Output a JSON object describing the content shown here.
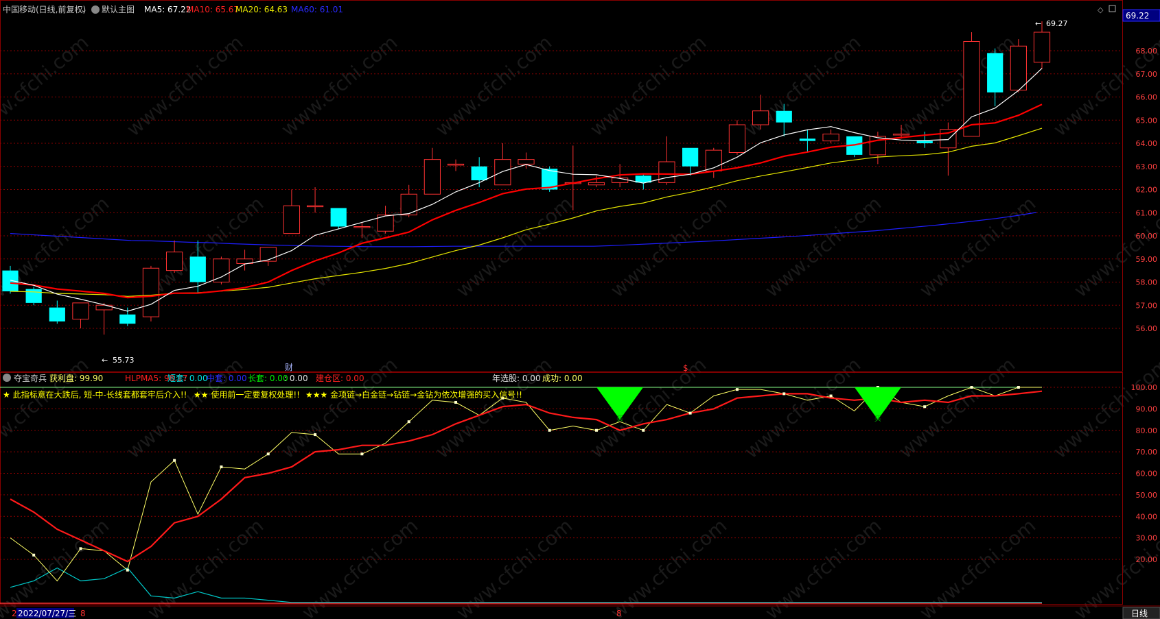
{
  "header": {
    "stock": "中国移动(日线,前复权)",
    "main_label": "默认主图",
    "ma5": "MA5: 67.22",
    "ma10": "MA10: 65.67",
    "ma20": "MA20: 64.63",
    "ma60": "MA60: 61.01"
  },
  "price_tag": "69.22",
  "annotations": {
    "high": "69.27",
    "low": "55.73",
    "cai_marker": "财",
    "dollar_marker": "$"
  },
  "indicator_header": {
    "name": "夺宝奇兵",
    "profit": "获利盘: 99.90",
    "hlpma5": "HLPMA5: 98.17",
    "short": "短套: 0.00",
    "mid": "中套: 0.00",
    "long_label": "长套: 0.00",
    "long_val": ": 0.00",
    "build_zone": "建仓区: 0.00",
    "year_pick": "年选股: 0.00",
    "success": "成功: 0.00"
  },
  "indicator_note": {
    "part1": "★ 此指标意在大跌后, 短-中-长线套都套牢后介入!!",
    "part2": "★★ 使用前一定要复权处理!!",
    "part3": "★★★ 金项链→白金链→钻链→金钻为依次增强的买入信号!!"
  },
  "bottom_bar": {
    "left_mark": "2",
    "date": "2022/07/27/三",
    "mid_mark": "8",
    "period_tab": "日线"
  },
  "buy_marker_label": "买",
  "watermark": "www.cfchi.com",
  "colors": {
    "up": "#ff3232",
    "down": "#00ffff",
    "ma5": "#ffffff",
    "ma10": "#ff0000",
    "ma20": "#e6e600",
    "ma60": "#1e1eff",
    "grid": "#8a0000",
    "profit": "#ffff66",
    "hlpma5": "#ff1a1a",
    "short": "#00cccc",
    "buy_signal": "#00ff00"
  },
  "chart_data": [
    {
      "type": "candlestick",
      "y_ticks": [
        "69.22",
        "68.00",
        "67.00",
        "66.00",
        "65.00",
        "64.00",
        "63.00",
        "62.00",
        "61.00",
        "60.00",
        "59.00",
        "58.00",
        "57.00",
        "56.00"
      ],
      "ylim": [
        55.5,
        69.5
      ],
      "candles": [
        {
          "o": 58.5,
          "c": 57.6,
          "h": 58.7,
          "l": 57.5
        },
        {
          "o": 57.7,
          "c": 57.1,
          "h": 57.8,
          "l": 57.0
        },
        {
          "o": 56.9,
          "c": 56.3,
          "h": 57.2,
          "l": 56.2
        },
        {
          "o": 56.4,
          "c": 57.1,
          "h": 57.1,
          "l": 56.0
        },
        {
          "o": 56.8,
          "c": 57.0,
          "h": 57.1,
          "l": 55.73
        },
        {
          "o": 56.6,
          "c": 56.2,
          "h": 56.9,
          "l": 56.1
        },
        {
          "o": 56.5,
          "c": 58.6,
          "h": 58.7,
          "l": 56.3
        },
        {
          "o": 58.5,
          "c": 59.3,
          "h": 59.8,
          "l": 58.4
        },
        {
          "o": 59.1,
          "c": 58.0,
          "h": 59.8,
          "l": 57.5
        },
        {
          "o": 58.0,
          "c": 59.0,
          "h": 59.1,
          "l": 57.9
        },
        {
          "o": 58.8,
          "c": 59.0,
          "h": 59.4,
          "l": 58.5
        },
        {
          "o": 58.9,
          "c": 59.5,
          "h": 59.5,
          "l": 58.7
        },
        {
          "o": 60.1,
          "c": 61.3,
          "h": 62.0,
          "l": 60.1
        },
        {
          "o": 61.3,
          "c": 61.3,
          "h": 62.1,
          "l": 61.0
        },
        {
          "o": 61.2,
          "c": 60.4,
          "h": 61.2,
          "l": 60.3
        },
        {
          "o": 60.4,
          "c": 60.4,
          "h": 60.6,
          "l": 59.9
        },
        {
          "o": 60.2,
          "c": 60.9,
          "h": 61.3,
          "l": 60.1
        },
        {
          "o": 60.9,
          "c": 61.8,
          "h": 62.2,
          "l": 60.8
        },
        {
          "o": 61.8,
          "c": 63.3,
          "h": 63.8,
          "l": 61.8
        },
        {
          "o": 63.1,
          "c": 63.1,
          "h": 63.3,
          "l": 62.8
        },
        {
          "o": 63.0,
          "c": 62.4,
          "h": 63.4,
          "l": 62.1
        },
        {
          "o": 62.2,
          "c": 63.3,
          "h": 64.0,
          "l": 62.2
        },
        {
          "o": 63.1,
          "c": 63.3,
          "h": 63.6,
          "l": 62.9
        },
        {
          "o": 62.9,
          "c": 62.0,
          "h": 63.0,
          "l": 61.9
        },
        {
          "o": 62.3,
          "c": 62.3,
          "h": 63.9,
          "l": 61.1
        },
        {
          "o": 62.2,
          "c": 62.3,
          "h": 62.6,
          "l": 62.1
        },
        {
          "o": 62.3,
          "c": 62.5,
          "h": 63.1,
          "l": 62.1
        },
        {
          "o": 62.6,
          "c": 62.3,
          "h": 62.7,
          "l": 62.0
        },
        {
          "o": 62.3,
          "c": 63.2,
          "h": 64.3,
          "l": 62.2
        },
        {
          "o": 63.8,
          "c": 63.0,
          "h": 63.8,
          "l": 62.6
        },
        {
          "o": 62.8,
          "c": 63.7,
          "h": 63.8,
          "l": 62.5
        },
        {
          "o": 63.6,
          "c": 64.8,
          "h": 65.0,
          "l": 63.5
        },
        {
          "o": 64.8,
          "c": 65.4,
          "h": 66.1,
          "l": 64.6
        },
        {
          "o": 65.4,
          "c": 64.9,
          "h": 65.7,
          "l": 64.3
        },
        {
          "o": 64.2,
          "c": 64.1,
          "h": 64.6,
          "l": 63.6
        },
        {
          "o": 64.1,
          "c": 64.4,
          "h": 64.6,
          "l": 64.0
        },
        {
          "o": 64.3,
          "c": 63.5,
          "h": 64.3,
          "l": 63.4
        },
        {
          "o": 63.5,
          "c": 64.3,
          "h": 64.5,
          "l": 63.1
        },
        {
          "o": 64.4,
          "c": 64.4,
          "h": 64.8,
          "l": 64.2
        },
        {
          "o": 64.1,
          "c": 64.0,
          "h": 64.5,
          "l": 63.8
        },
        {
          "o": 63.8,
          "c": 64.6,
          "h": 64.9,
          "l": 62.6
        },
        {
          "o": 64.3,
          "c": 68.4,
          "h": 68.8,
          "l": 64.3
        },
        {
          "o": 67.9,
          "c": 66.2,
          "h": 68.1,
          "l": 65.6
        },
        {
          "o": 66.3,
          "c": 68.2,
          "h": 68.5,
          "l": 66.2
        },
        {
          "o": 67.5,
          "c": 68.8,
          "h": 69.27,
          "l": 67.2
        }
      ],
      "ma60": [
        60.1,
        60.05,
        60.0,
        59.95,
        59.9,
        59.85,
        59.8,
        59.78,
        59.75,
        59.72,
        59.7,
        59.66,
        59.63,
        59.6,
        59.58,
        59.56,
        59.55,
        59.54,
        59.53,
        59.53,
        59.53,
        59.54,
        59.55,
        59.55,
        59.55,
        59.55,
        59.55,
        59.55,
        59.55,
        59.55,
        59.58,
        59.62,
        59.66,
        59.7,
        59.74,
        59.78,
        59.83,
        59.88,
        59.93,
        59.98,
        60.04,
        60.1,
        60.16,
        60.22,
        60.3,
        60.38,
        60.46,
        60.55,
        60.65,
        60.75,
        60.87,
        61.01
      ]
    },
    {
      "type": "line",
      "y_ticks": [
        "100.00",
        "90.00",
        "80.00",
        "70.00",
        "60.00",
        "50.00",
        "40.00",
        "30.00",
        "20.00"
      ],
      "ylim": [
        0,
        100
      ],
      "series": [
        {
          "name": "获利盘",
          "values": [
            30,
            22,
            10,
            25,
            24,
            15,
            56,
            66,
            41,
            63,
            62,
            69,
            79,
            78,
            69,
            69,
            74,
            84,
            94,
            93,
            87,
            95,
            93,
            80,
            82,
            80,
            84,
            80,
            92,
            88,
            96,
            99,
            99,
            97,
            94,
            96,
            89,
            100,
            93,
            91,
            96,
            100,
            96,
            100,
            100
          ]
        },
        {
          "name": "HLPMA5",
          "values": [
            48,
            42,
            34,
            29,
            24,
            19,
            26,
            37,
            40,
            48,
            58,
            60,
            63,
            70,
            71,
            73,
            73,
            75,
            78,
            83,
            87,
            91,
            92,
            88,
            86,
            85,
            80,
            83,
            85,
            88,
            90,
            95,
            96,
            97,
            97,
            95,
            94,
            95,
            93,
            94,
            93,
            96,
            96,
            97,
            98.17
          ]
        },
        {
          "name": "短套",
          "values": [
            7,
            10,
            16,
            10,
            11,
            16,
            3,
            2,
            5,
            2,
            2,
            1,
            0,
            0,
            0,
            0,
            0,
            0,
            0,
            0,
            0,
            0,
            0,
            0,
            0,
            0,
            0,
            0,
            0,
            0,
            0,
            0,
            0,
            0,
            0,
            0,
            0,
            0,
            0,
            0,
            0,
            0,
            0,
            0,
            0
          ]
        }
      ]
    }
  ]
}
